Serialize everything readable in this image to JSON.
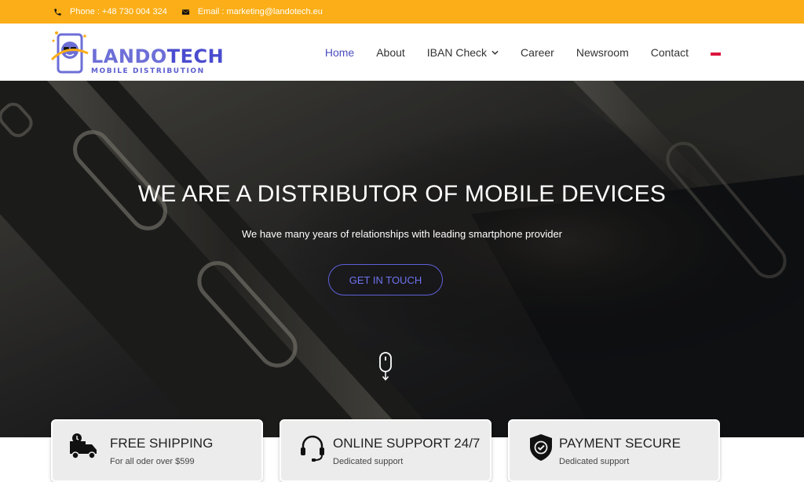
{
  "topbar": {
    "phone_key": "Phone :",
    "phone_value": "+48 730 004 324",
    "email_key": "Email :",
    "email_value": "marketing@landotech.eu"
  },
  "logo": {
    "name_part1": "LANDO",
    "name_part2": "TECH",
    "tagline": "MOBILE DISTRIBUTION"
  },
  "nav": {
    "items": [
      {
        "label": "Home"
      },
      {
        "label": "About"
      },
      {
        "label": "IBAN Check"
      },
      {
        "label": "Career"
      },
      {
        "label": "Newsroom"
      },
      {
        "label": "Contact"
      }
    ],
    "language_flag": "polish-flag"
  },
  "hero": {
    "title": "WE ARE A DISTRIBUTOR OF MOBILE DEVICES",
    "subtitle": "We have many years of relationships with leading smartphone provider",
    "cta_label": "GET IN TOUCH",
    "scroll_icon": "mouse-scroll-icon"
  },
  "features": [
    {
      "icon": "delivery-truck-icon",
      "title": "FREE SHIPPING",
      "desc": "For all oder over $599"
    },
    {
      "icon": "headset-icon",
      "title": "ONLINE SUPPORT 24/7",
      "desc": "Dedicated support"
    },
    {
      "icon": "shield-check-icon",
      "title": "PAYMENT SECURE",
      "desc": "Dedicated support"
    }
  ],
  "colors": {
    "topbar": "#fbae17",
    "brand": "#4b4dbf",
    "cta_border": "#5f61d8"
  }
}
